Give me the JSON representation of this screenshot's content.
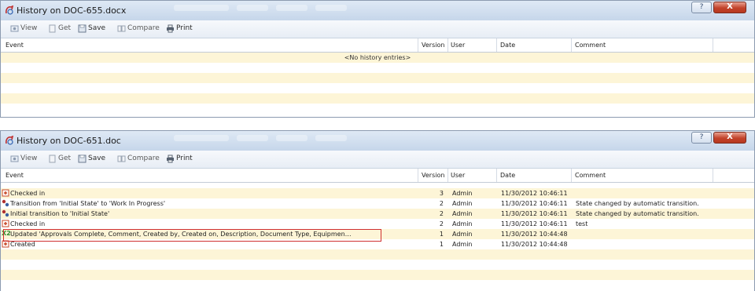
{
  "windows": [
    {
      "title": "History on DOC-655.docx",
      "controls": {
        "help": "?",
        "close": "X"
      },
      "toolbar": {
        "view": "View",
        "get": "Get",
        "save": "Save",
        "compare": "Compare",
        "print": "Print"
      },
      "columns": {
        "event": "Event",
        "version": "Version",
        "user": "User",
        "date": "Date",
        "comment": "Comment"
      },
      "empty_text": "<No history entries>",
      "rows": []
    },
    {
      "title": "History on DOC-651.doc",
      "controls": {
        "help": "?",
        "close": "X"
      },
      "toolbar": {
        "view": "View",
        "get": "Get",
        "save": "Save",
        "compare": "Compare",
        "print": "Print"
      },
      "columns": {
        "event": "Event",
        "version": "Version",
        "user": "User",
        "date": "Date",
        "comment": "Comment"
      },
      "rows": [
        {
          "icon": "checked-in-icon",
          "event": "Checked in",
          "version": "3",
          "user": "Admin",
          "date": "11/30/2012 10:46:11",
          "comment": ""
        },
        {
          "icon": "transition-icon",
          "event": "Transition from 'Initial State' to 'Work In Progress'",
          "version": "2",
          "user": "Admin",
          "date": "11/30/2012 10:46:11",
          "comment": "State changed by automatic transition."
        },
        {
          "icon": "transition-icon",
          "event": "Initial transition to 'Initial State'",
          "version": "2",
          "user": "Admin",
          "date": "11/30/2012 10:46:11",
          "comment": "State changed by automatic transition."
        },
        {
          "icon": "checked-in-icon",
          "event": "Checked in",
          "version": "2",
          "user": "Admin",
          "date": "11/30/2012 10:46:11",
          "comment": "test"
        },
        {
          "icon": "x2-update-icon",
          "event": "Updated 'Approvals Complete, Comment, Created by, Created on, Description, Document Type, Equipmen…",
          "version": "1",
          "user": "Admin",
          "date": "11/30/2012 10:44:48",
          "comment": ""
        },
        {
          "icon": "created-icon",
          "event": "Created",
          "version": "1",
          "user": "Admin",
          "date": "11/30/2012 10:44:48",
          "comment": ""
        }
      ],
      "x2_glyph": "X2"
    }
  ],
  "colors": {
    "row_alt": "#fdf5d7",
    "highlight_border": "#d03030",
    "title_bg": "#c6d6ea"
  }
}
